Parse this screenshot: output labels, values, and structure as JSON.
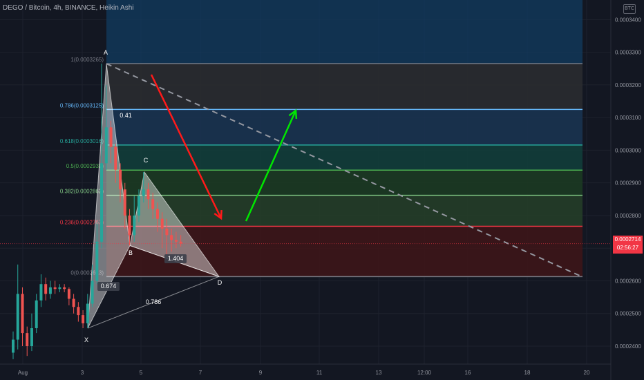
{
  "header": {
    "title": "DEGO / Bitcoin, 4h, BINANCE, Heikin Ashi",
    "currency_badge": "BTC"
  },
  "price_tag": {
    "price": "0.0002714",
    "countdown": "02:56:27"
  },
  "colors": {
    "background": "#131722",
    "up": "#26a69a",
    "down": "#ef5350",
    "price_tag": "#f23645"
  },
  "chart_data": {
    "type": "candlestick",
    "title": "DEGO / Bitcoin, 4h, BINANCE, Heikin Ashi",
    "ylim": [
      0.0002345,
      0.000346
    ],
    "y_ticks": [
      "0.0003400",
      "0.0003300",
      "0.0003200",
      "0.0003100",
      "0.0003000",
      "0.0002900",
      "0.0002800",
      "0.0002700",
      "0.0002600",
      "0.0002500",
      "0.0002400"
    ],
    "x_ticks": [
      "Aug",
      "3",
      "5",
      "7",
      "9",
      "11",
      "13",
      "12:00",
      "16",
      "18",
      "20"
    ],
    "last_price": 0.0002714,
    "fibonacci": {
      "levels": [
        {
          "ratio": 1,
          "label": "1(0.0003265)",
          "price": 0.0003265,
          "color": "#787b86"
        },
        {
          "ratio": 0.786,
          "label": "0.786(0.0003125)",
          "price": 0.0003125,
          "color": "#64b5f6"
        },
        {
          "ratio": 0.618,
          "label": "0.618(0.0003016)",
          "price": 0.0003016,
          "color": "#26a69a"
        },
        {
          "ratio": 0.5,
          "label": "0.5(0.0002939)",
          "price": 0.0002939,
          "color": "#4caf50"
        },
        {
          "ratio": 0.382,
          "label": "0.382(0.0002862)",
          "price": 0.0002862,
          "color": "#81c784"
        },
        {
          "ratio": 0.236,
          "label": "0.236(0.0002767)",
          "price": 0.0002767,
          "color": "#f23645"
        },
        {
          "ratio": 0,
          "label": "0(0.0002613)",
          "price": 0.0002613,
          "color": "#787b86"
        }
      ]
    },
    "harmonic_pattern": {
      "points": [
        {
          "label": "X",
          "price": 0.0002455
        },
        {
          "label": "A",
          "price": 0.0003265
        },
        {
          "label": "B",
          "price": 0.0002708
        },
        {
          "label": "C",
          "price": 0.0002933
        },
        {
          "label": "D",
          "price": 0.0002613
        }
      ],
      "ratios": [
        "0.41",
        "0.674",
        "0.786",
        "1.404"
      ]
    },
    "candles": [
      {
        "o": 0.000238,
        "c": 0.000242,
        "h": 0.0002445,
        "l": 0.000236
      },
      {
        "o": 0.000242,
        "c": 0.000256,
        "h": 0.000265,
        "l": 0.000239
      },
      {
        "o": 0.000256,
        "c": 0.000244,
        "h": 0.000258,
        "l": 0.00024
      },
      {
        "o": 0.000244,
        "c": 0.00024,
        "h": 0.000246,
        "l": 0.000237
      },
      {
        "o": 0.00024,
        "c": 0.0002455,
        "h": 0.00025,
        "l": 0.0002385
      },
      {
        "o": 0.0002455,
        "c": 0.000254,
        "h": 0.000256,
        "l": 0.000244
      },
      {
        "o": 0.000254,
        "c": 0.000259,
        "h": 0.000262,
        "l": 0.000252
      },
      {
        "o": 0.000259,
        "c": 0.000256,
        "h": 0.000261,
        "l": 0.000254
      },
      {
        "o": 0.000256,
        "c": 0.000258,
        "h": 0.00026,
        "l": 0.0002545
      },
      {
        "o": 0.000258,
        "c": 0.0002575,
        "h": 0.00026,
        "l": 0.000256
      },
      {
        "o": 0.0002575,
        "c": 0.000258,
        "h": 0.000259,
        "l": 0.0002565
      },
      {
        "o": 0.000258,
        "c": 0.0002575,
        "h": 0.000259,
        "l": 0.0002565
      },
      {
        "o": 0.0002575,
        "c": 0.0002545,
        "h": 0.000258,
        "l": 0.0002525
      },
      {
        "o": 0.0002545,
        "c": 0.000252,
        "h": 0.000256,
        "l": 0.00025
      },
      {
        "o": 0.000252,
        "c": 0.0002495,
        "h": 0.0002535,
        "l": 0.0002475
      },
      {
        "o": 0.0002495,
        "c": 0.000247,
        "h": 0.000251,
        "l": 0.0002455
      },
      {
        "o": 0.000247,
        "c": 0.000253,
        "h": 0.000256,
        "l": 0.0002455
      },
      {
        "o": 0.000253,
        "c": 0.00026,
        "h": 0.000265,
        "l": 0.000252
      },
      {
        "o": 0.00026,
        "c": 0.000272,
        "h": 0.000278,
        "l": 0.000259
      },
      {
        "o": 0.000272,
        "c": 0.000296,
        "h": 0.0003265,
        "l": 0.00027
      },
      {
        "o": 0.000296,
        "c": 0.000307,
        "h": 0.00032,
        "l": 0.000294
      },
      {
        "o": 0.000307,
        "c": 0.000301,
        "h": 0.000309,
        "l": 0.000296
      },
      {
        "o": 0.000301,
        "c": 0.000294,
        "h": 0.000302,
        "l": 0.00029
      },
      {
        "o": 0.000294,
        "c": 0.000288,
        "h": 0.000296,
        "l": 0.000284
      },
      {
        "o": 0.000288,
        "c": 0.00028,
        "h": 0.00029,
        "l": 0.000276
      },
      {
        "o": 0.00028,
        "c": 0.000274,
        "h": 0.000282,
        "l": 0.0002708
      },
      {
        "o": 0.000274,
        "c": 0.00028,
        "h": 0.000286,
        "l": 0.000272
      },
      {
        "o": 0.00028,
        "c": 0.000286,
        "h": 0.000288,
        "l": 0.000278
      },
      {
        "o": 0.000286,
        "c": 0.000288,
        "h": 0.0002933,
        "l": 0.000284
      },
      {
        "o": 0.000288,
        "c": 0.000285,
        "h": 0.00029,
        "l": 0.000282
      },
      {
        "o": 0.000285,
        "c": 0.000282,
        "h": 0.000287,
        "l": 0.000279
      },
      {
        "o": 0.000282,
        "c": 0.000279,
        "h": 0.000284,
        "l": 0.000275
      },
      {
        "o": 0.000279,
        "c": 0.000276,
        "h": 0.000281,
        "l": 0.00027
      },
      {
        "o": 0.000276,
        "c": 0.000274,
        "h": 0.000279,
        "l": 0.000268
      },
      {
        "o": 0.000274,
        "c": 0.0002725,
        "h": 0.000276,
        "l": 0.000269
      },
      {
        "o": 0.0002725,
        "c": 0.000272,
        "h": 0.000275,
        "l": 0.00027
      },
      {
        "o": 0.000272,
        "c": 0.0002714,
        "h": 0.000274,
        "l": 0.0002705
      }
    ]
  }
}
